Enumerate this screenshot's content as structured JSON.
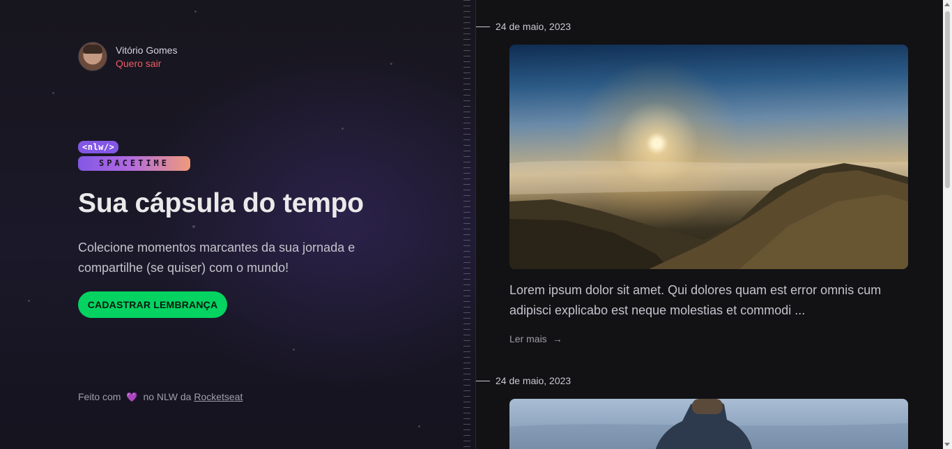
{
  "user": {
    "name": "Vitório Gomes",
    "logout_label": "Quero sair"
  },
  "logo": {
    "top": "<nlw/>",
    "bottom": "SPACETIME"
  },
  "hero": {
    "title": "Sua cápsula do tempo",
    "subtitle": "Colecione momentos marcantes da sua jornada e compartilhe (se quiser) com o mundo!",
    "cta_label": "CADASTRAR LEMBRANÇA"
  },
  "footer": {
    "made_with": "Feito com",
    "heart": "💜",
    "on": "no NLW da",
    "link": "Rocketseat"
  },
  "memories": [
    {
      "date": "24 de maio, 2023",
      "excerpt": "Lorem ipsum dolor sit amet. Qui dolores quam est error omnis cum adipisci explicabo est neque molestias et commodi ...",
      "read_more": "Ler mais",
      "arrow": "→"
    },
    {
      "date": "24 de maio, 2023"
    }
  ],
  "colors": {
    "accent": "#8257e5",
    "cta": "#04d361",
    "logout": "#ef5f67",
    "background": "#121215"
  }
}
